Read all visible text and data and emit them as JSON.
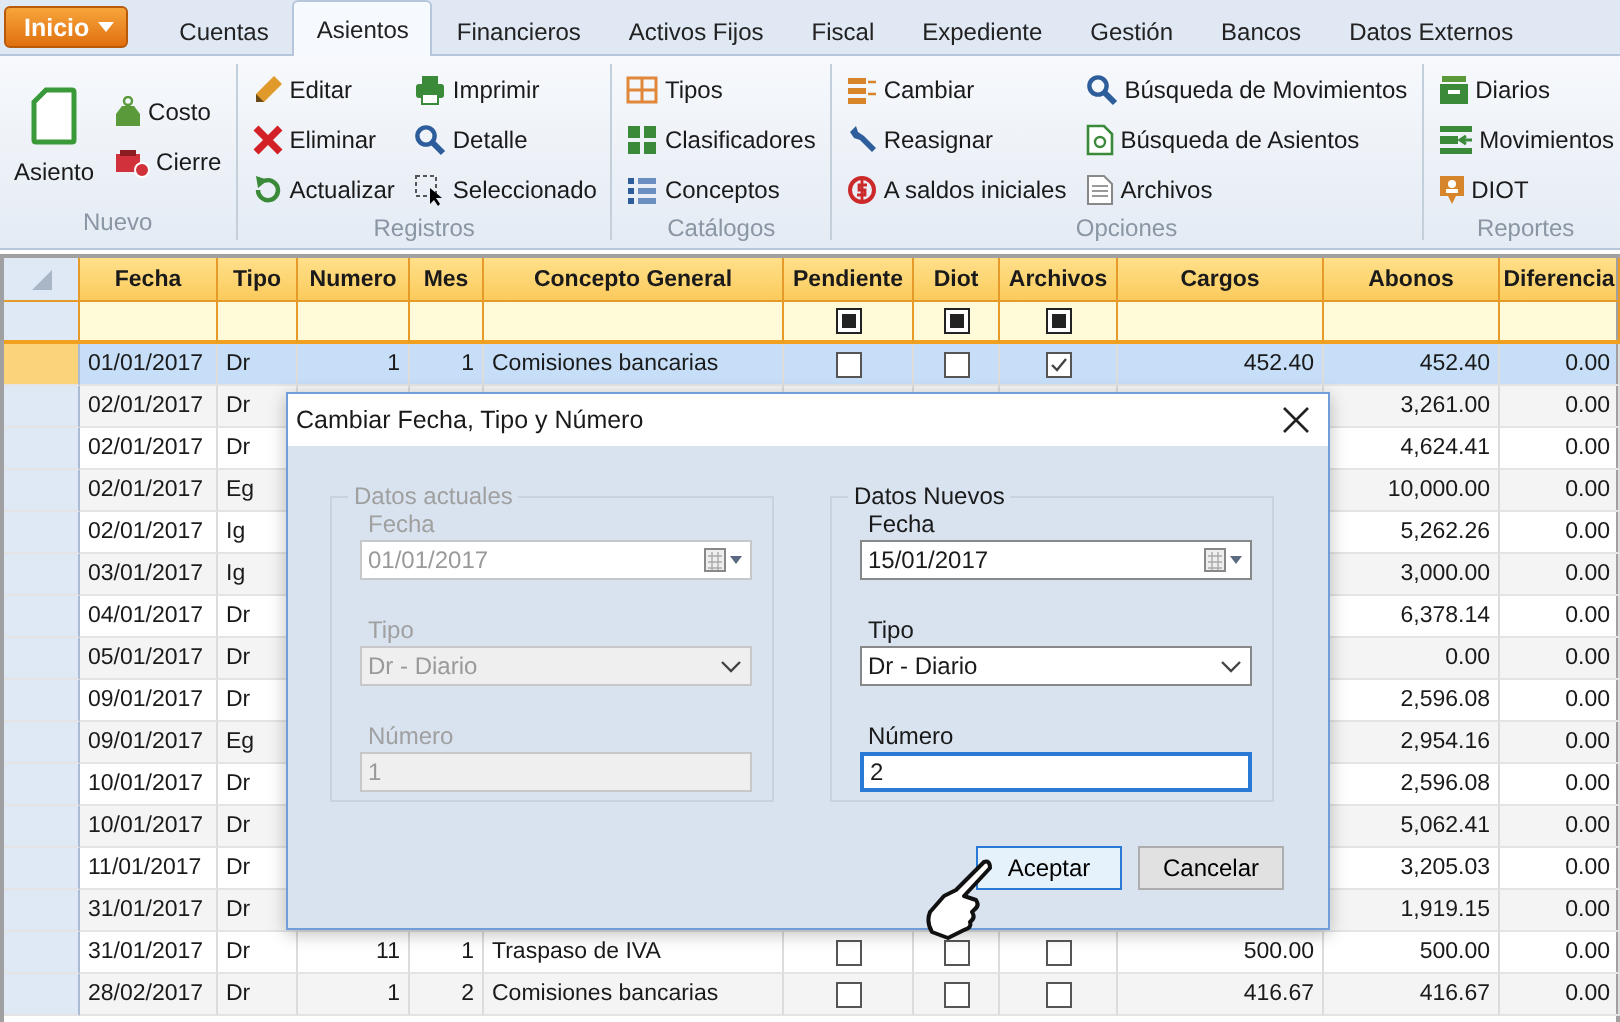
{
  "ribbon": {
    "start_button": "Inicio",
    "tabs": [
      {
        "label": "Cuentas",
        "selected": false
      },
      {
        "label": "Asientos",
        "selected": true
      },
      {
        "label": "Financieros",
        "selected": false
      },
      {
        "label": "Activos Fijos",
        "selected": false
      },
      {
        "label": "Fiscal",
        "selected": false
      },
      {
        "label": "Expediente",
        "selected": false
      },
      {
        "label": "Gestión",
        "selected": false
      },
      {
        "label": "Bancos",
        "selected": false
      },
      {
        "label": "Datos Externos",
        "selected": false
      }
    ],
    "groups": [
      {
        "label": "Nuevo",
        "items": [
          {
            "label": "Asiento",
            "kind": "large"
          },
          {
            "label": "Costo",
            "kind": "small"
          },
          {
            "label": "Cierre",
            "kind": "small"
          }
        ]
      },
      {
        "label": "Registros",
        "items": [
          {
            "label": "Editar",
            "kind": "small"
          },
          {
            "label": "Eliminar",
            "kind": "small"
          },
          {
            "label": "Actualizar",
            "kind": "small"
          },
          {
            "label": "Imprimir",
            "kind": "small"
          },
          {
            "label": "Detalle",
            "kind": "small"
          },
          {
            "label": "Seleccionado",
            "kind": "small"
          }
        ]
      },
      {
        "label": "Catálogos",
        "items": [
          {
            "label": "Tipos",
            "kind": "small"
          },
          {
            "label": "Clasificadores",
            "kind": "small"
          },
          {
            "label": "Conceptos",
            "kind": "small"
          }
        ]
      },
      {
        "label": "Opciones",
        "items": [
          {
            "label": "Cambiar",
            "kind": "small"
          },
          {
            "label": "Reasignar",
            "kind": "small"
          },
          {
            "label": "A saldos iniciales",
            "kind": "small"
          },
          {
            "label": "Búsqueda de Movimientos",
            "kind": "small"
          },
          {
            "label": "Búsqueda de Asientos",
            "kind": "small"
          },
          {
            "label": "Archivos",
            "kind": "small"
          }
        ]
      },
      {
        "label": "Reportes",
        "items": [
          {
            "label": "Diarios",
            "kind": "small"
          },
          {
            "label": "Movimientos",
            "kind": "small"
          },
          {
            "label": "DIOT",
            "kind": "small"
          }
        ]
      }
    ]
  },
  "table": {
    "columns": [
      {
        "label": "Fecha",
        "kind": "text"
      },
      {
        "label": "Tipo",
        "kind": "text"
      },
      {
        "label": "Numero",
        "kind": "num"
      },
      {
        "label": "Mes",
        "kind": "num"
      },
      {
        "label": "Concepto General",
        "kind": "text"
      },
      {
        "label": "Pendiente",
        "kind": "check",
        "filter_indeterminate": true
      },
      {
        "label": "Diot",
        "kind": "check",
        "filter_indeterminate": true
      },
      {
        "label": "Archivos",
        "kind": "check",
        "filter_indeterminate": true
      },
      {
        "label": "Cargos",
        "kind": "num"
      },
      {
        "label": "Abonos",
        "kind": "num"
      },
      {
        "label": "Diferencia",
        "kind": "num"
      }
    ],
    "rows": [
      {
        "selected": true,
        "fecha": "01/01/2017",
        "tipo": "Dr",
        "numero": "1",
        "mes": "1",
        "concepto": "Comisiones bancarias",
        "pendiente": false,
        "diot": false,
        "archivos": true,
        "cargos": "452.40",
        "abonos": "452.40",
        "diferencia": "0.00"
      },
      {
        "selected": false,
        "fecha": "02/01/2017",
        "tipo": "Dr",
        "abonos": "3,261.00",
        "diferencia": "0.00"
      },
      {
        "selected": false,
        "fecha": "02/01/2017",
        "tipo": "Dr",
        "abonos": "4,624.41",
        "diferencia": "0.00"
      },
      {
        "selected": false,
        "fecha": "02/01/2017",
        "tipo": "Eg",
        "abonos": "10,000.00",
        "diferencia": "0.00"
      },
      {
        "selected": false,
        "fecha": "02/01/2017",
        "tipo": "Ig",
        "abonos": "5,262.26",
        "diferencia": "0.00"
      },
      {
        "selected": false,
        "fecha": "03/01/2017",
        "tipo": "Ig",
        "abonos": "3,000.00",
        "diferencia": "0.00"
      },
      {
        "selected": false,
        "fecha": "04/01/2017",
        "tipo": "Dr",
        "abonos": "6,378.14",
        "diferencia": "0.00"
      },
      {
        "selected": false,
        "fecha": "05/01/2017",
        "tipo": "Dr",
        "abonos": "0.00",
        "diferencia": "0.00"
      },
      {
        "selected": false,
        "fecha": "09/01/2017",
        "tipo": "Dr",
        "abonos": "2,596.08",
        "diferencia": "0.00"
      },
      {
        "selected": false,
        "fecha": "09/01/2017",
        "tipo": "Eg",
        "abonos": "2,954.16",
        "diferencia": "0.00"
      },
      {
        "selected": false,
        "fecha": "10/01/2017",
        "tipo": "Dr",
        "abonos": "2,596.08",
        "diferencia": "0.00"
      },
      {
        "selected": false,
        "fecha": "10/01/2017",
        "tipo": "Dr",
        "abonos": "5,062.41",
        "diferencia": "0.00"
      },
      {
        "selected": false,
        "fecha": "11/01/2017",
        "tipo": "Dr",
        "abonos": "3,205.03",
        "diferencia": "0.00"
      },
      {
        "selected": false,
        "fecha": "31/01/2017",
        "tipo": "Dr",
        "abonos": "1,919.15",
        "diferencia": "0.00"
      },
      {
        "selected": false,
        "fecha": "31/01/2017",
        "tipo": "Dr",
        "numero": "11",
        "mes": "1",
        "concepto": "Traspaso de IVA",
        "pendiente": false,
        "diot": false,
        "archivos": false,
        "cargos": "500.00",
        "abonos": "500.00",
        "diferencia": "0.00"
      },
      {
        "selected": false,
        "fecha": "28/02/2017",
        "tipo": "Dr",
        "numero": "1",
        "mes": "2",
        "concepto": "Comisiones bancarias",
        "pendiente": false,
        "diot": false,
        "archivos": false,
        "cargos": "416.67",
        "abonos": "416.67",
        "diferencia": "0.00"
      }
    ]
  },
  "dialog": {
    "title": "Cambiar Fecha, Tipo y Número",
    "groups": [
      {
        "legend": "Datos actuales",
        "disabled": true,
        "fields": [
          {
            "kind": "date",
            "label": "Fecha",
            "value": "01/01/2017",
            "focused": false
          },
          {
            "kind": "select",
            "label": "Tipo",
            "value": "Dr - Diario",
            "focused": false
          },
          {
            "kind": "text",
            "label": "Número",
            "value": "1",
            "focused": false
          }
        ]
      },
      {
        "legend": "Datos Nuevos",
        "disabled": false,
        "fields": [
          {
            "kind": "date",
            "label": "Fecha",
            "value": "15/01/2017",
            "focused": false
          },
          {
            "kind": "select",
            "label": "Tipo",
            "value": "Dr - Diario",
            "focused": false
          },
          {
            "kind": "text",
            "label": "Número",
            "value": "2",
            "focused": true
          }
        ]
      }
    ],
    "buttons": [
      {
        "label": "Aceptar",
        "default": true
      },
      {
        "label": "Cancelar",
        "default": false
      }
    ]
  }
}
